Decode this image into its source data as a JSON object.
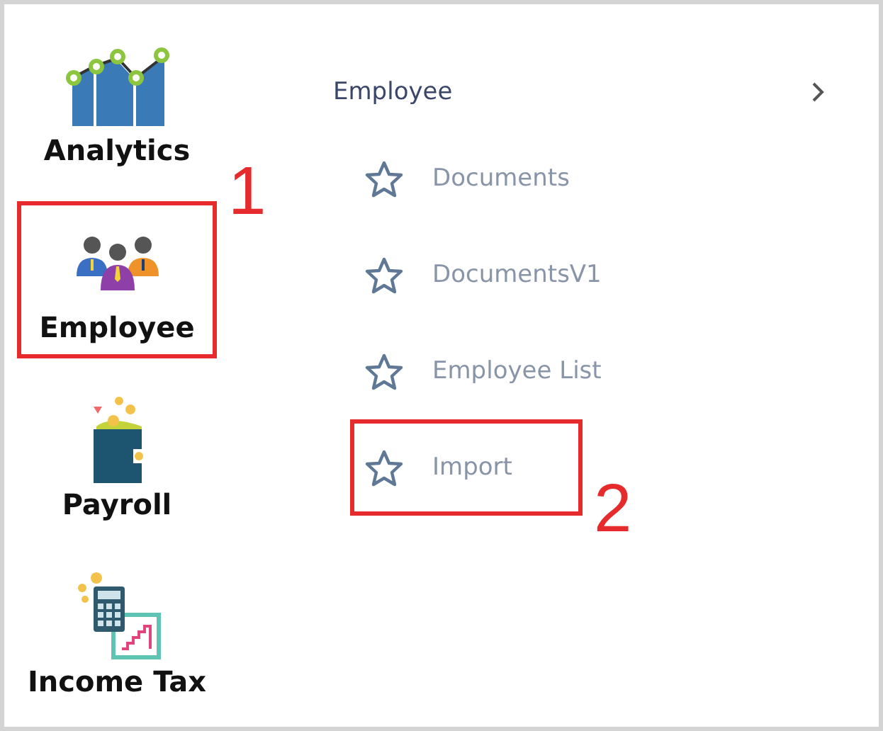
{
  "sidebar": {
    "items": [
      {
        "label": "Analytics"
      },
      {
        "label": "Employee",
        "callout": "1"
      },
      {
        "label": "Payroll"
      },
      {
        "label": "Income Tax"
      }
    ]
  },
  "submenu": {
    "title": "Employee",
    "items": [
      {
        "label": "Documents"
      },
      {
        "label": "DocumentsV1"
      },
      {
        "label": "Employee List"
      },
      {
        "label": "Import",
        "callout": "2"
      }
    ]
  }
}
